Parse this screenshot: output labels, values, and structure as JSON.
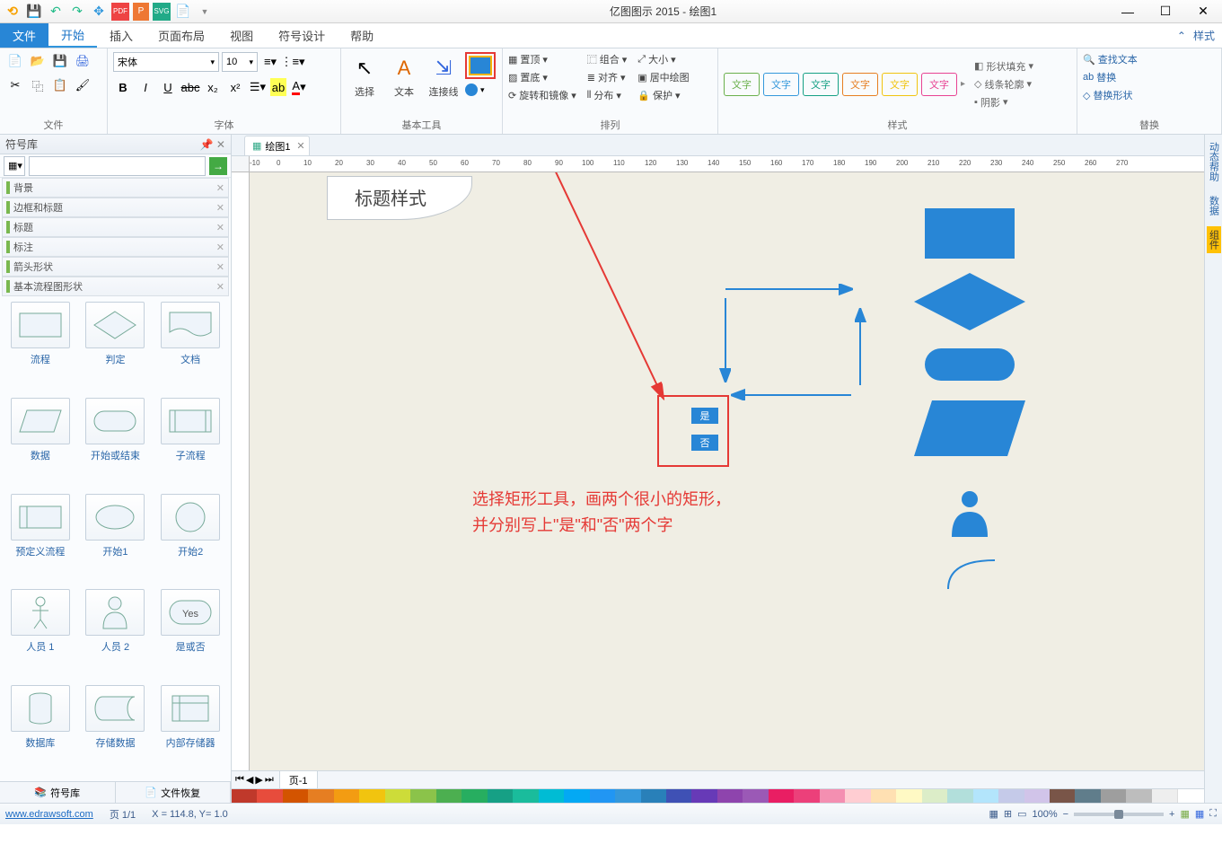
{
  "app": {
    "title": "亿图图示 2015 - 绘图1"
  },
  "qat": [
    "logo",
    "save",
    "undo",
    "redo",
    "move",
    "pdf",
    "p",
    "svg",
    "new",
    "drop"
  ],
  "menu": {
    "file": "文件",
    "tabs": [
      "开始",
      "插入",
      "页面布局",
      "视图",
      "符号设计",
      "帮助"
    ],
    "right_collapse": "⌃",
    "right_style": "样式"
  },
  "ribbon": {
    "file_group": "文件",
    "font_group": "字体",
    "font_name": "宋体",
    "font_size": "10",
    "tools_group": "基本工具",
    "tool_select": "选择",
    "tool_text": "文本",
    "tool_conn": "连接线",
    "arrange_group": "排列",
    "arr_top": "置顶",
    "arr_bottom": "置底",
    "arr_rotate": "旋转和镜像",
    "arr_group": "组合",
    "arr_align": "对齐",
    "arr_dist": "分布",
    "arr_size": "大小",
    "arr_center": "居中绘图",
    "arr_protect": "保护",
    "style_group": "样式",
    "style_label": "文字",
    "fill": "形状填充",
    "line": "线条轮廓",
    "shadow": "阴影",
    "replace_group": "替换",
    "find": "查找文本",
    "repl": "替换",
    "repshape": "替换形状"
  },
  "symlib": {
    "title": "符号库",
    "categories": [
      "背景",
      "边框和标题",
      "标题",
      "标注",
      "箭头形状",
      "基本流程图形状"
    ],
    "shapes": [
      "流程",
      "判定",
      "文档",
      "数据",
      "开始或结束",
      "子流程",
      "预定义流程",
      "开始1",
      "开始2",
      "人员 1",
      "人员 2",
      "是或否",
      "数据库",
      "存储数据",
      "内部存储器"
    ],
    "yes": "Yes",
    "tab1": "符号库",
    "tab2": "文件恢复"
  },
  "doc": {
    "tab": "绘图1",
    "page_tab": "页-1"
  },
  "canvas": {
    "title_style": "标题样式",
    "yes": "是",
    "no": "否",
    "annotation_line1": "选择矩形工具，画两个很小的矩形，",
    "annotation_line2": "并分别写上\"是\"和\"否\"两个字"
  },
  "rightrail": {
    "help": "动态帮助",
    "data": "数据",
    "misc": "组件"
  },
  "status": {
    "url": "www.edrawsoft.com",
    "page": "页 1/1",
    "coords": "X = 114.8, Y= 1.0",
    "zoom": "100%"
  }
}
